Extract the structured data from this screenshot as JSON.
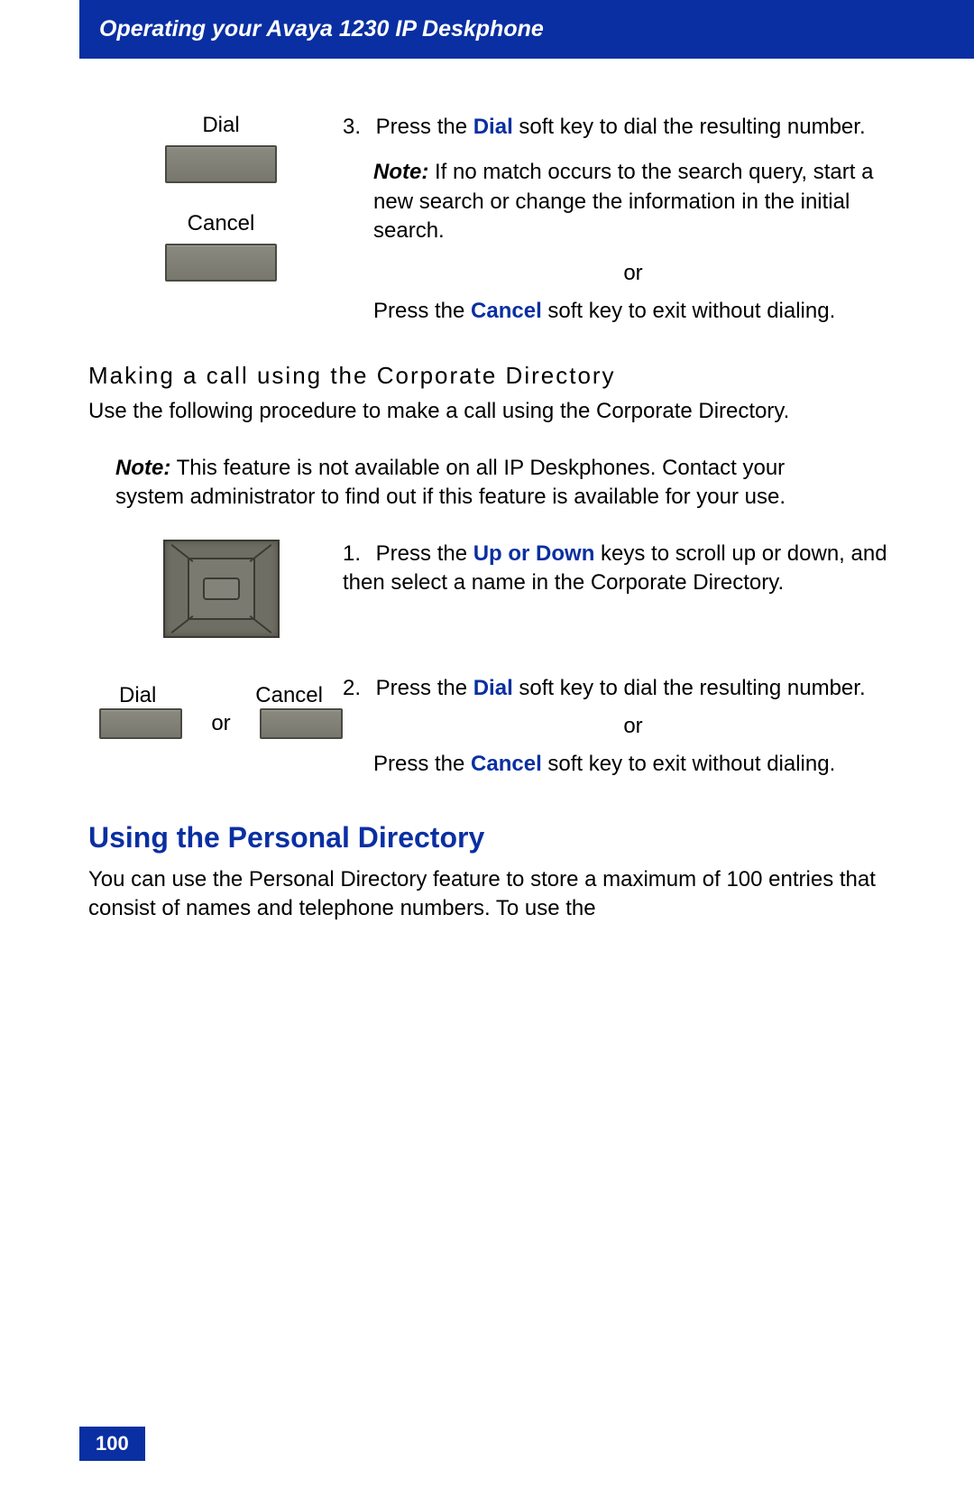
{
  "header": {
    "title": "Operating your Avaya 1230 IP Deskphone"
  },
  "block1": {
    "dial_label": "Dial",
    "cancel_label": "Cancel",
    "step_num": "3.",
    "step_text_1a": "Press the ",
    "step_text_1_bold": "Dial",
    "step_text_1b": " soft key to dial the resulting number.",
    "note_label": "Note:",
    "note_text": " If no match occurs to the search query, start a new search or change the information in the initial search.",
    "or_label": "or",
    "step_text_2a": "Press the ",
    "step_text_2_bold": "Cancel",
    "step_text_2b": " soft key to exit without dialing."
  },
  "subheading": "Making a call using the Corporate Directory",
  "sub_intro": "Use the following procedure to make a call using the Corporate Directory.",
  "note2": {
    "label": "Note:",
    "text": " This feature is not available on all IP Deskphones. Contact your system administrator to find out if this feature is available for your use."
  },
  "block2": {
    "step1_num": "1.",
    "step1_a": "Press the ",
    "step1_bold": "Up or Down",
    "step1_b": " keys to scroll up or down, and then select a name in the Corporate Directory.",
    "step2_num": "2.",
    "step2_a": "Press the ",
    "step2_bold": "Dial",
    "step2_b": " soft key to dial the resulting number.",
    "or_label": "or",
    "step2_c": "Press the ",
    "step2_bold2": "Cancel",
    "step2_d": " soft key to exit without dialing.",
    "dial_label": "Dial",
    "cancel_label": "Cancel",
    "or_inline": "or"
  },
  "section_heading": "Using the Personal Directory",
  "section_text": "You can use the Personal Directory feature to store a maximum of 100 entries that consist of names and telephone numbers. To use the",
  "page_number": "100"
}
